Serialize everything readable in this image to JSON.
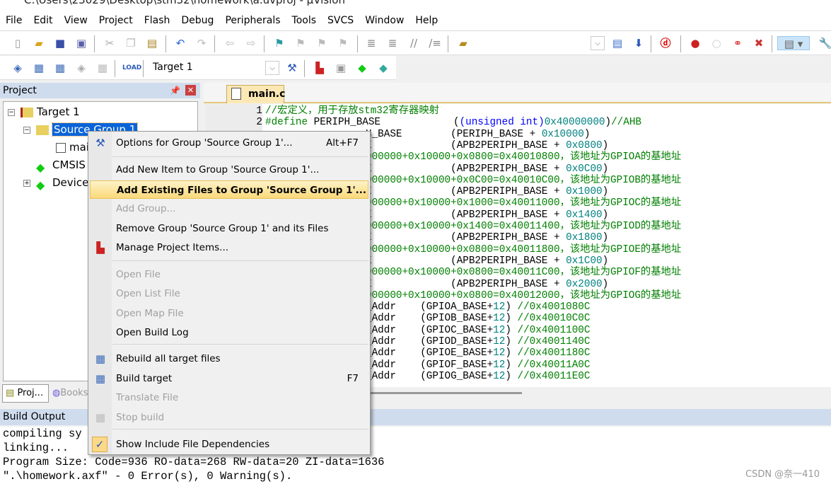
{
  "title": "C:\\Users\\23029\\Desktop\\stm32\\homework\\a.uvproj - µVision",
  "menubar": [
    "File",
    "Edit",
    "View",
    "Project",
    "Flash",
    "Debug",
    "Peripherals",
    "Tools",
    "SVCS",
    "Window",
    "Help"
  ],
  "toolbar2": {
    "target": "Target 1"
  },
  "project_panel": {
    "title": "Project",
    "tree": {
      "target": "Target 1",
      "group": "Source Group 1",
      "file": "main.c",
      "cmsis": "CMSIS",
      "device": "Device"
    },
    "tabs": [
      "Proj...",
      "Books"
    ]
  },
  "editor": {
    "tab": "main.c",
    "line1": "//宏定义，用于存放stm32寄存器映射",
    "line2": {
      "a": "#define",
      "b": " PERIPH_BASE            (",
      "c": "(unsigned int)",
      "d": "0x40000000",
      "e": ")",
      "f": "//AHB"
    },
    "lines": [
      [
        [
          "H_BASE        (PERIPH_BASE + ",
          "t"
        ],
        [
          "0x10000",
          "n"
        ],
        [
          ")",
          "t"
        ]
      ],
      [
        [
          "E             (APB2PERIPH_BASE + ",
          "t"
        ],
        [
          "0x0800",
          "n"
        ],
        [
          ")",
          "t"
        ]
      ],
      [
        [
          "000000+0x10000+0x0800=0x40010800，该地址为GPIOA的基地址",
          "c"
        ]
      ],
      [
        [
          "E             (APB2PERIPH_BASE + ",
          "t"
        ],
        [
          "0x0C00",
          "n"
        ],
        [
          ")",
          "t"
        ]
      ],
      [
        [
          "000000+0x10000+0x0C00=0x40010C00，该地址为GPIOB的基地址",
          "c"
        ]
      ],
      [
        [
          "E             (APB2PERIPH_BASE + ",
          "t"
        ],
        [
          "0x1000",
          "n"
        ],
        [
          ")",
          "t"
        ]
      ],
      [
        [
          "000000+0x10000+0x1000=0x40011000，该地址为GPIOC的基地址",
          "c"
        ]
      ],
      [
        [
          "E             (APB2PERIPH_BASE + ",
          "t"
        ],
        [
          "0x1400",
          "n"
        ],
        [
          ")",
          "t"
        ]
      ],
      [
        [
          "000000+0x10000+0x1400=0x40011400，该地址为GPIOD的基地址",
          "c"
        ]
      ],
      [
        [
          "E             (APB2PERIPH_BASE + ",
          "t"
        ],
        [
          "0x1800",
          "n"
        ],
        [
          ")",
          "t"
        ]
      ],
      [
        [
          "000000+0x10000+0x0800=0x40011800，该地址为GPIOE的基地址",
          "c"
        ]
      ],
      [
        [
          "E             (APB2PERIPH_BASE + ",
          "t"
        ],
        [
          "0x1C00",
          "n"
        ],
        [
          ")",
          "t"
        ]
      ],
      [
        [
          "000000+0x10000+0x0800=0x40011C00，该地址为GPIOF的基地址",
          "c"
        ]
      ],
      [
        [
          "E             (APB2PERIPH_BASE + ",
          "t"
        ],
        [
          "0x2000",
          "n"
        ],
        [
          ")",
          "t"
        ]
      ],
      [
        [
          "000000+0x10000+0x0800=0x40012000，该地址为GPIOG的基地址",
          "c"
        ]
      ],
      [
        [
          "_Addr    (GPIOA_BASE+",
          "t"
        ],
        [
          "12",
          "n"
        ],
        [
          ") ",
          "t"
        ],
        [
          "//0x4001080C",
          "c"
        ]
      ],
      [
        [
          "_Addr    (GPIOB_BASE+",
          "t"
        ],
        [
          "12",
          "n"
        ],
        [
          ") ",
          "t"
        ],
        [
          "//0x40010C0C",
          "c"
        ]
      ],
      [
        [
          "_Addr    (GPIOC_BASE+",
          "t"
        ],
        [
          "12",
          "n"
        ],
        [
          ") ",
          "t"
        ],
        [
          "//0x4001100C",
          "c"
        ]
      ],
      [
        [
          "_Addr    (GPIOD_BASE+",
          "t"
        ],
        [
          "12",
          "n"
        ],
        [
          ") ",
          "t"
        ],
        [
          "//0x4001140C",
          "c"
        ]
      ],
      [
        [
          "_Addr    (GPIOE_BASE+",
          "t"
        ],
        [
          "12",
          "n"
        ],
        [
          ") ",
          "t"
        ],
        [
          "//0x4001180C",
          "c"
        ]
      ],
      [
        [
          "_Addr    (GPIOF_BASE+",
          "t"
        ],
        [
          "12",
          "n"
        ],
        [
          ") ",
          "t"
        ],
        [
          "//0x40011A0C",
          "c"
        ]
      ],
      [
        [
          "_Addr    (GPIOG_BASE+",
          "t"
        ],
        [
          "12",
          "n"
        ],
        [
          ") ",
          "t"
        ],
        [
          "//0x40011E0C",
          "c"
        ]
      ]
    ]
  },
  "context_menu": [
    {
      "label": "Options for Group 'Source Group 1'...",
      "shortcut": "Alt+F7",
      "icon": "magic-wand-icon"
    },
    {
      "label": "Add New  Item to Group 'Source Group 1'..."
    },
    {
      "label": "Add Existing Files to Group 'Source Group 1'...",
      "highlighted": true
    },
    {
      "label": "Add Group...",
      "disabled": true
    },
    {
      "label": "Remove Group 'Source Group 1' and its Files"
    },
    {
      "label": "Manage Project Items...",
      "icon": "manage-items-icon"
    },
    {
      "label": "Open File",
      "disabled": true
    },
    {
      "label": "Open List File",
      "disabled": true
    },
    {
      "label": "Open Map File",
      "disabled": true
    },
    {
      "label": "Open Build Log"
    },
    {
      "label": "Rebuild all target files",
      "icon": "rebuild-icon"
    },
    {
      "label": "Build target",
      "shortcut": "F7",
      "icon": "build-icon"
    },
    {
      "label": "Translate File",
      "disabled": true
    },
    {
      "label": "Stop build",
      "disabled": true,
      "icon": "stop-build-icon"
    },
    {
      "label": "Show Include File Dependencies",
      "checked": true
    }
  ],
  "build_output": {
    "title": "Build Output",
    "lines": [
      "compiling sy",
      "linking...",
      "Program Size: Code=936 RO-data=268 RW-data=20 ZI-data=1636",
      "\".\\homework.axf\" - 0 Error(s), 0 Warning(s)."
    ]
  },
  "watermark": "CSDN @奈一410"
}
